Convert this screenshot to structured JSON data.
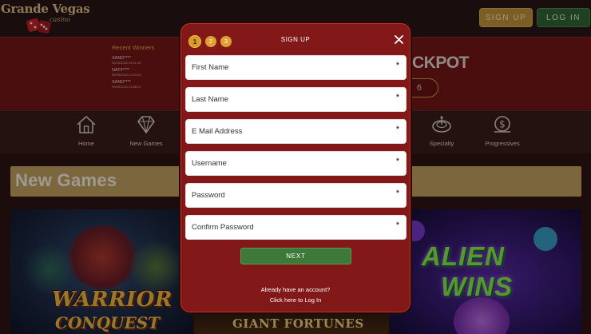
{
  "header": {
    "logo_brand": "Grande Vegas",
    "logo_sub": "casino",
    "signup_label": "SIGN UP",
    "login_label": "LOG IN"
  },
  "recent_winners": {
    "title": "Recent Winners",
    "entries": [
      {
        "name": "SAND****",
        "date": "09/25/2022 03:11:49"
      },
      {
        "name": "NAT4****",
        "date": "09/25/2022 23:21:53"
      },
      {
        "name": "SAND****",
        "date": "09/25/2022 23:08:11"
      }
    ]
  },
  "jackpot": {
    "label": "CKPOT",
    "value_fragment": "6"
  },
  "categories": [
    {
      "label": "Home",
      "icon": "home-icon"
    },
    {
      "label": "New Games",
      "icon": "diamond-icon"
    },
    {
      "label": "Specialty",
      "icon": "roulette-icon"
    },
    {
      "label": "Progressives",
      "icon": "money-icon"
    }
  ],
  "section": {
    "title": "New Games"
  },
  "games": {
    "warrior": {
      "line1": "WARRIOR",
      "line2": "CONQUEST"
    },
    "giant": {
      "title": "GIANT FORTUNES"
    },
    "alien": {
      "line1": "ALIEN",
      "line2": "WINS"
    }
  },
  "modal": {
    "title": "SIGN UP",
    "steps": [
      "1",
      "2",
      "3"
    ],
    "active_step": 1,
    "fields": [
      {
        "placeholder": "First Name",
        "value": ""
      },
      {
        "placeholder": "Last Name",
        "value": ""
      },
      {
        "placeholder": "E Mail Address",
        "value": ""
      },
      {
        "placeholder": "Username",
        "value": ""
      },
      {
        "placeholder": "Password",
        "value": ""
      },
      {
        "placeholder": "Confirm Password",
        "value": ""
      }
    ],
    "required_marker": "*",
    "next_label": "NEXT",
    "already_text": "Already have an account?",
    "login_link": "Click here to Log In"
  },
  "colors": {
    "modal_bg": "#831818",
    "accent_gold": "#c9983a",
    "accent_green": "#336936",
    "next_green": "#3d7a3a"
  }
}
